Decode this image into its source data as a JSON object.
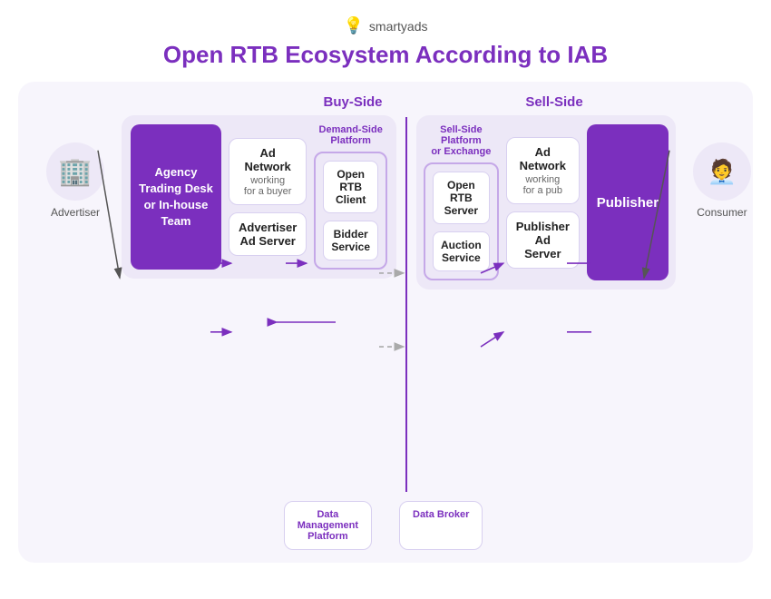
{
  "logo": {
    "icon": "💡",
    "text": "smartyads"
  },
  "title": "Open RTB Ecosystem According to IAB",
  "sections": {
    "buy_side": "Buy-Side",
    "sell_side": "Sell-Side"
  },
  "actors": {
    "advertiser": {
      "label": "Advertiser",
      "icon": "🏢"
    },
    "consumer": {
      "label": "Consumer",
      "icon": "👤"
    }
  },
  "buy_side": {
    "agency_box": {
      "line1": "Agency",
      "line2": "Trading Desk",
      "line3": "or In-house",
      "line4": "Team"
    },
    "ad_network": {
      "title": "Ad Network",
      "subtitle": "working\nfor a buyer"
    },
    "advertiser_ad_server": {
      "title": "Advertiser",
      "subtitle": "Ad Server"
    },
    "dsp_label": "Demand-Side\nPlatform",
    "open_rtb_client": "Open RTB\nClient",
    "bidder_service": "Bidder\nService"
  },
  "sell_side": {
    "ssp_label": "Sell-Side\nPlatform\nor Exchange",
    "open_rtb_server": "Open RTB\nServer",
    "auction_service": "Auction\nService",
    "ad_network": {
      "title": "Ad Network",
      "subtitle": "working\nfor a pub"
    },
    "publisher_ad_server": {
      "title": "Publisher\nAd Server"
    },
    "publisher_box": "Publisher"
  },
  "bottom": {
    "dmp": "Data\nManagement\nPlatform",
    "data_broker": "Data Broker"
  }
}
